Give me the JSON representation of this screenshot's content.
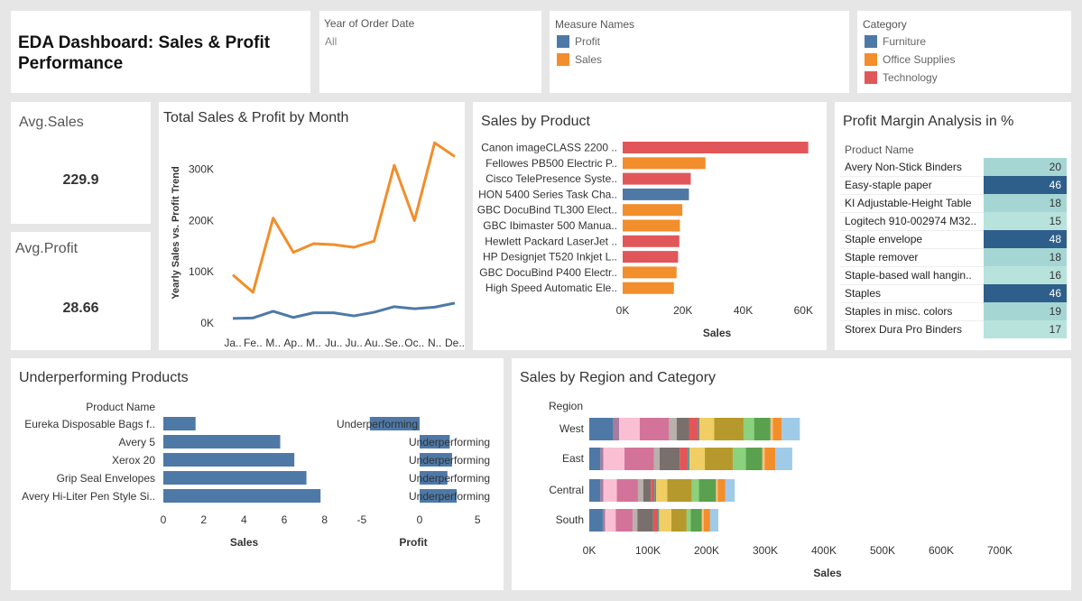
{
  "dashboard": {
    "title_line1": "EDA Dashboard: Sales & Profit",
    "title_line2": "Performance"
  },
  "filters": {
    "year": {
      "label": "Year of Order Date",
      "value": "All"
    },
    "measure_names": {
      "label": "Measure Names",
      "items": [
        {
          "name": "Profit",
          "color": "#4e79a7"
        },
        {
          "name": "Sales",
          "color": "#f28e2b"
        }
      ]
    },
    "category": {
      "label": "Category",
      "items": [
        {
          "name": "Furniture",
          "color": "#4e79a7"
        },
        {
          "name": "Office Supplies",
          "color": "#f28e2b"
        },
        {
          "name": "Technology",
          "color": "#e15759"
        }
      ]
    }
  },
  "kpis": {
    "avg_sales": {
      "label": "Avg.Sales",
      "value": "229.9"
    },
    "avg_profit": {
      "label": "Avg.Profit",
      "value": "28.66"
    }
  },
  "chart_data": [
    {
      "id": "monthly",
      "type": "line",
      "title": "Total Sales & Profit by Month",
      "ylabel": "Yearly Sales vs. Profit Trend",
      "categories": [
        "Ja..",
        "Fe..",
        "M..",
        "Ap..",
        "M..",
        "Ju..",
        "Ju..",
        "Au..",
        "Se..",
        "Oc..",
        "N..",
        "De.."
      ],
      "ylim": [
        0,
        370000
      ],
      "yticks": [
        {
          "v": 0,
          "label": "0K"
        },
        {
          "v": 100000,
          "label": "100K"
        },
        {
          "v": 200000,
          "label": "200K"
        },
        {
          "v": 300000,
          "label": "300K"
        }
      ],
      "series": [
        {
          "name": "Sales",
          "color": "#f28e2b",
          "values": [
            94000,
            60000,
            205000,
            138000,
            155000,
            153000,
            148000,
            160000,
            308000,
            200000,
            352000,
            325000
          ]
        },
        {
          "name": "Profit",
          "color": "#4e79a7",
          "values": [
            9000,
            10000,
            23000,
            11000,
            20000,
            20000,
            14000,
            21000,
            32000,
            28000,
            31000,
            39000
          ]
        }
      ]
    },
    {
      "id": "product",
      "type": "bar",
      "title": "Sales by Product",
      "xlabel": "Sales",
      "xlim": [
        0,
        65000
      ],
      "xticks": [
        {
          "v": 0,
          "label": "0K"
        },
        {
          "v": 20000,
          "label": "20K"
        },
        {
          "v": 40000,
          "label": "40K"
        },
        {
          "v": 60000,
          "label": "60K"
        }
      ],
      "categories": [
        "Canon imageCLASS 2200 ..",
        "Fellowes PB500 Electric P..",
        "Cisco TelePresence Syste..",
        "HON 5400 Series Task Cha..",
        "GBC DocuBind TL300 Elect..",
        "GBC Ibimaster 500 Manua..",
        "Hewlett Packard LaserJet ..",
        "HP Designjet T520 Inkjet L..",
        "GBC DocuBind P400 Electr..",
        "High Speed Automatic Ele.."
      ],
      "values": [
        61600,
        27500,
        22600,
        22000,
        19800,
        19000,
        18800,
        18400,
        17900,
        17000
      ],
      "colors": [
        "#e15759",
        "#f28e2b",
        "#e15759",
        "#4e79a7",
        "#f28e2b",
        "#f28e2b",
        "#e15759",
        "#e15759",
        "#f28e2b",
        "#f28e2b"
      ]
    },
    {
      "id": "underperf",
      "type": "bar",
      "title": "Underperforming Products",
      "row_header": "Product Name",
      "categories": [
        "Eureka Disposable Bags f..",
        "Avery 5",
        "Xerox 20",
        "Grip Seal Envelopes",
        "Avery Hi-Liter Pen Style Si.."
      ],
      "sales": [
        1.6,
        5.8,
        6.5,
        7.1,
        7.8
      ],
      "profit": [
        -4.3,
        2.6,
        2.8,
        2.4,
        3.2
      ],
      "labels": [
        "Underperforming",
        "Underperforming",
        "Underperforming",
        "Underperforming",
        "Underperforming"
      ],
      "sales_axis": {
        "label": "Sales",
        "lim": [
          0,
          9
        ],
        "ticks": [
          {
            "v": 0,
            "label": "0"
          },
          {
            "v": 2,
            "label": "2"
          },
          {
            "v": 4,
            "label": "4"
          },
          {
            "v": 6,
            "label": "6"
          },
          {
            "v": 8,
            "label": "8"
          }
        ]
      },
      "profit_axis": {
        "label": "Profit",
        "lim": [
          -6,
          6
        ],
        "ticks": [
          {
            "v": -5,
            "label": "-5"
          },
          {
            "v": 0,
            "label": "0"
          },
          {
            "v": 5,
            "label": "5"
          }
        ]
      },
      "color": "#4e79a7"
    },
    {
      "id": "region",
      "type": "bar",
      "stacked": true,
      "title": "Sales by Region and Category",
      "row_header": "Region",
      "xlabel": "Sales",
      "xlim": [
        0,
        760000
      ],
      "xticks": [
        {
          "v": 0,
          "label": "0K"
        },
        {
          "v": 100000,
          "label": "100K"
        },
        {
          "v": 200000,
          "label": "200K"
        },
        {
          "v": 300000,
          "label": "300K"
        },
        {
          "v": 400000,
          "label": "400K"
        },
        {
          "v": 500000,
          "label": "500K"
        },
        {
          "v": 600000,
          "label": "600K"
        },
        {
          "v": 700000,
          "label": "700K"
        }
      ],
      "colors": [
        "#4e79a7",
        "#a87c9f",
        "#fabfd2",
        "#d4739a",
        "#bab0ac",
        "#79706e",
        "#e15759",
        "#499894",
        "#f1ce63",
        "#b6992d",
        "#8cd17d",
        "#59a14f",
        "#ffbe7d",
        "#f28e2b",
        "#a0cbe8"
      ],
      "categories": [
        "West",
        "East",
        "Central",
        "South"
      ],
      "series": [
        [
          41000,
          10000,
          35000,
          50000,
          13000,
          21000,
          16000,
          2000,
          25000,
          50000,
          18000,
          28000,
          4000,
          15000,
          31000
        ],
        [
          19000,
          5000,
          36000,
          50000,
          10000,
          34000,
          14000,
          3000,
          26000,
          48000,
          22000,
          28000,
          4000,
          18000,
          29000
        ],
        [
          19000,
          5000,
          23000,
          36000,
          9000,
          13000,
          6000,
          3000,
          19000,
          42000,
          12000,
          29000,
          3000,
          13000,
          16000
        ],
        [
          23000,
          4000,
          18000,
          29000,
          8000,
          27000,
          8000,
          2000,
          21000,
          26000,
          7000,
          19000,
          3000,
          11000,
          14000
        ]
      ]
    }
  ],
  "profit_margin": {
    "title": "Profit Margin Analysis in %",
    "header": "Product Name",
    "rows": [
      {
        "name": "Avery Non-Stick Binders",
        "value": "20",
        "color": "#a6d6d4"
      },
      {
        "name": "Easy-staple paper",
        "value": "46",
        "color": "#2e5f8a"
      },
      {
        "name": "KI Adjustable-Height Table",
        "value": "18",
        "color": "#a6d6d4"
      },
      {
        "name": "Logitech 910-002974 M32..",
        "value": "15",
        "color": "#b8e2dc"
      },
      {
        "name": "Staple envelope",
        "value": "48",
        "color": "#2e5f8a"
      },
      {
        "name": "Staple remover",
        "value": "18",
        "color": "#a6d6d4"
      },
      {
        "name": "Staple-based wall hangin..",
        "value": "16",
        "color": "#b8e2dc"
      },
      {
        "name": "Staples",
        "value": "46",
        "color": "#2e5f8a"
      },
      {
        "name": "Staples in misc. colors",
        "value": "19",
        "color": "#a6d6d4"
      },
      {
        "name": "Storex Dura Pro Binders",
        "value": "17",
        "color": "#b8e2dc"
      }
    ]
  }
}
